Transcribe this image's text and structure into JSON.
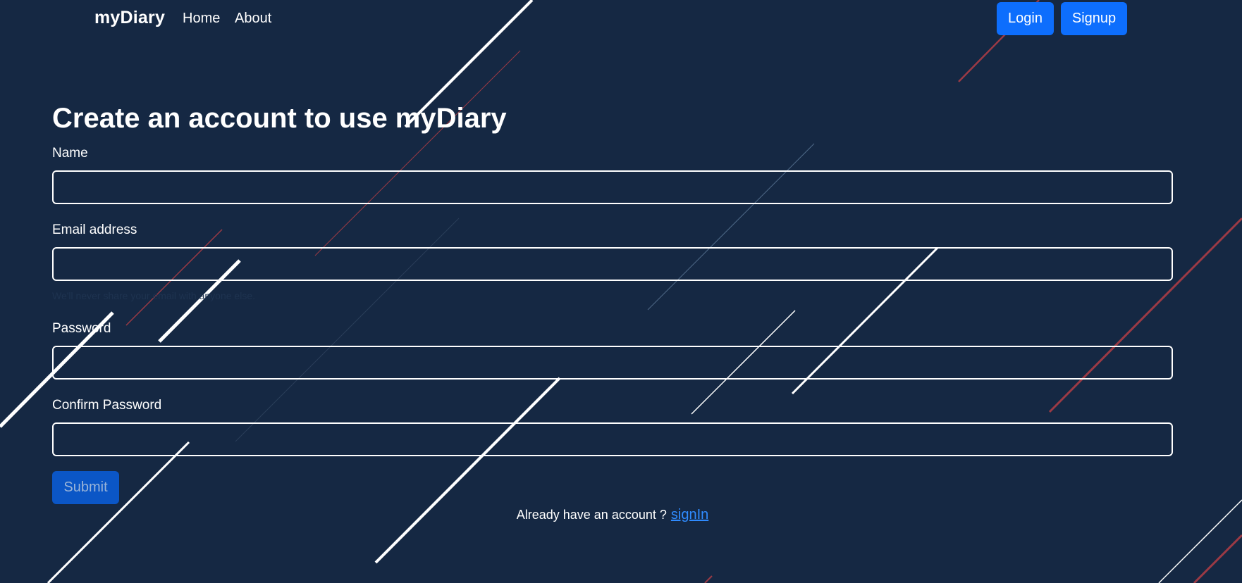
{
  "navbar": {
    "brand": "myDiary",
    "links": [
      "Home",
      "About"
    ],
    "login_label": "Login",
    "signup_label": "Signup"
  },
  "form": {
    "title": "Create an account to use myDiary",
    "name_label": "Name",
    "name_value": "",
    "email_label": "Email address",
    "email_value": "",
    "email_help": "We'll never share your email with anyone else.",
    "password_label": "Password",
    "password_value": "",
    "confirm_label": "Confirm Password",
    "confirm_value": "",
    "submit_label": "Submit",
    "signin_prompt": "Already have an account ?",
    "signin_link": "signIn"
  },
  "colors": {
    "background": "#152843",
    "primary": "#0d6efd",
    "submit_bg": "#0b56c6",
    "link": "#2f8bff",
    "accent_red": "#9b3a45"
  }
}
